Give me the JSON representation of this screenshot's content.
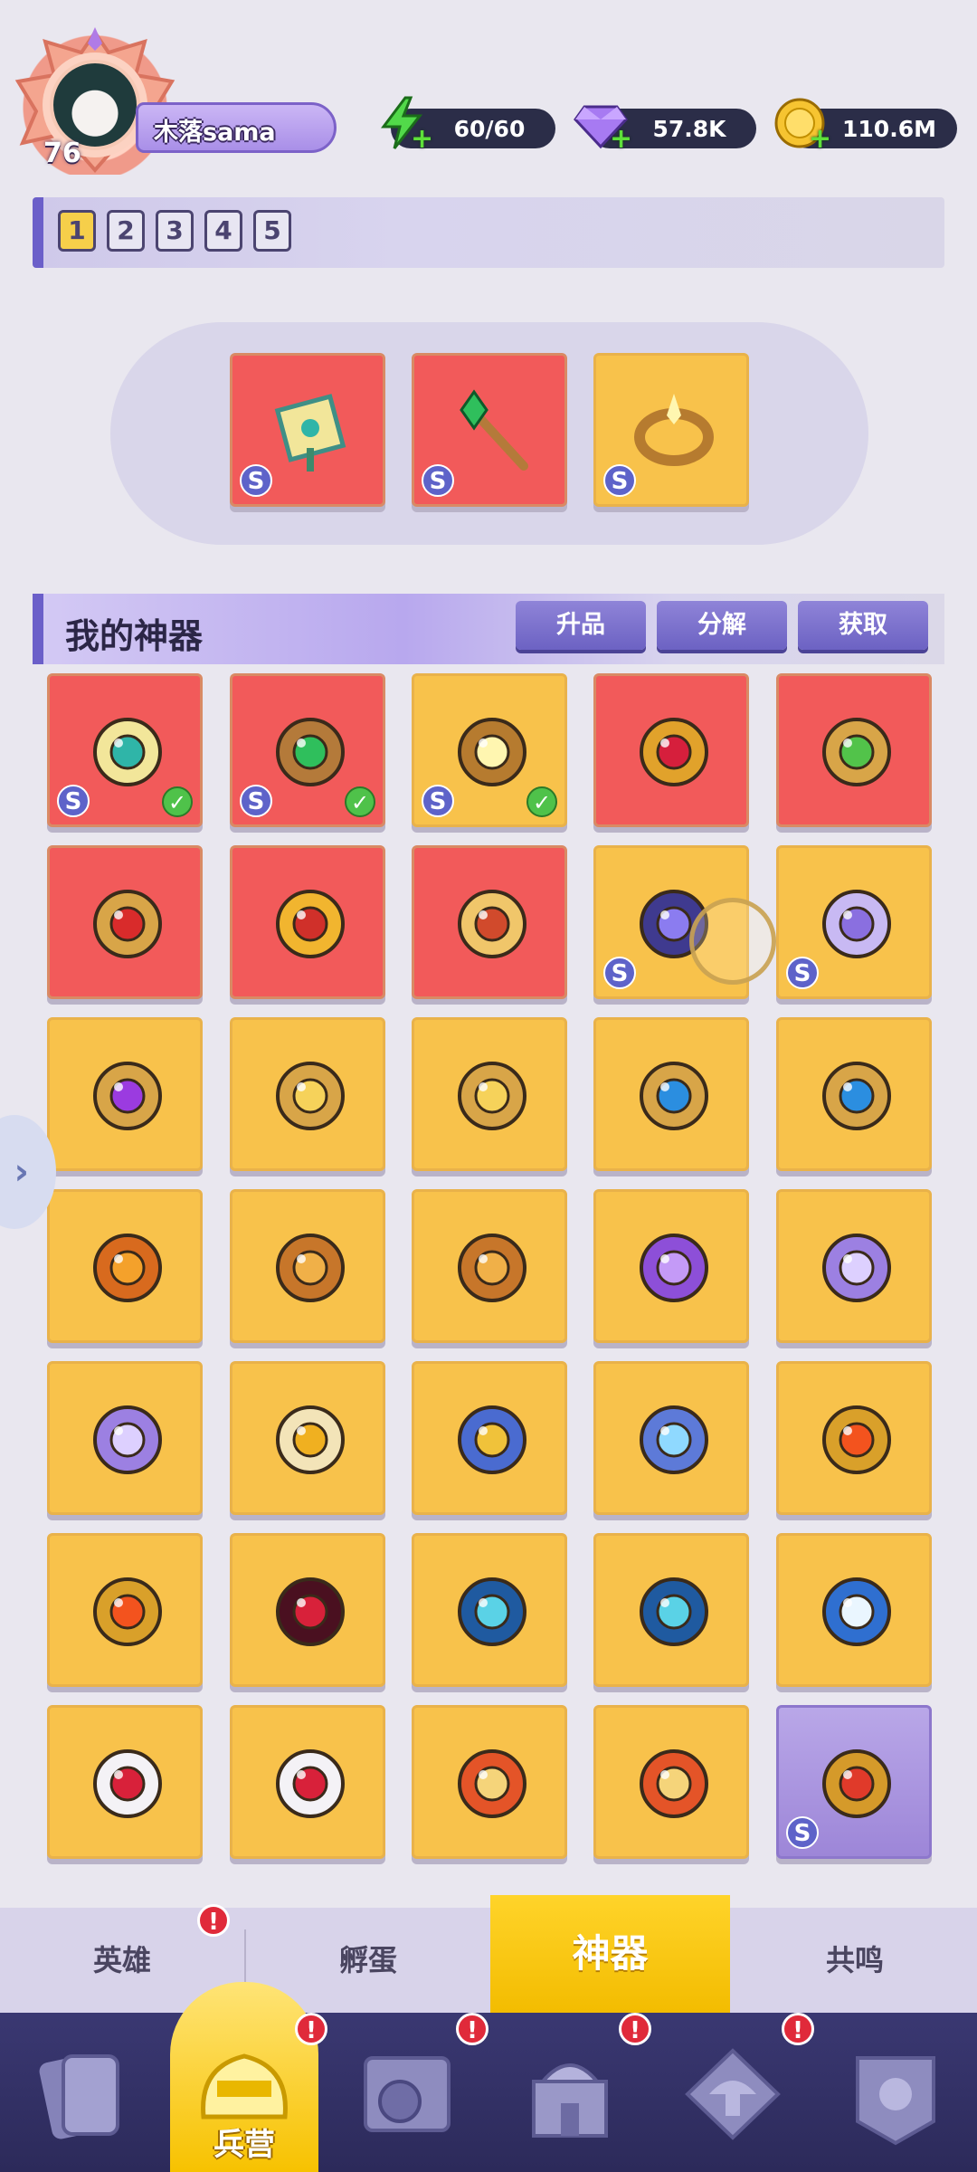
{
  "player": {
    "level": "76",
    "name": "木落sama"
  },
  "resources": {
    "energy": "60/60",
    "gems": "57.8K",
    "gold": "110.6M"
  },
  "page_tabs": [
    "1",
    "2",
    "3",
    "4",
    "5"
  ],
  "active_page": "1",
  "equipped": [
    {
      "icon": "map-scroll-icon",
      "grade": "S"
    },
    {
      "icon": "emerald-staff-icon",
      "grade": "S"
    },
    {
      "icon": "golden-ring-icon",
      "grade": "S"
    }
  ],
  "section": {
    "title": "我的神器",
    "buttons": [
      "升品",
      "分解",
      "获取"
    ]
  },
  "artifacts": [
    {
      "icon": "map-scroll-icon",
      "bg": "red",
      "grade": "S",
      "equipped": true
    },
    {
      "icon": "emerald-staff-icon",
      "bg": "red",
      "grade": "S",
      "equipped": true
    },
    {
      "icon": "golden-ring-icon",
      "bg": "gold",
      "grade": "S",
      "equipped": true
    },
    {
      "icon": "ruby-heart-crown-icon",
      "bg": "red",
      "grade": "",
      "equipped": false
    },
    {
      "icon": "green-amulet-icon",
      "bg": "red",
      "grade": "",
      "equipped": false
    },
    {
      "icon": "red-amulet-icon",
      "bg": "red",
      "grade": "",
      "equipped": false
    },
    {
      "icon": "jeweled-crown-icon",
      "bg": "red",
      "grade": "",
      "equipped": false
    },
    {
      "icon": "magic-scroll-icon",
      "bg": "red",
      "grade": "",
      "equipped": false
    },
    {
      "icon": "dark-wing-icon",
      "bg": "gold",
      "grade": "S",
      "equipped": false
    },
    {
      "icon": "crystal-orb-icon",
      "bg": "gold",
      "grade": "S",
      "equipped": false
    },
    {
      "icon": "purple-amulet-icon",
      "bg": "gold",
      "grade": "",
      "equipped": false
    },
    {
      "icon": "gold-amulet-icon",
      "bg": "gold",
      "grade": "",
      "equipped": false
    },
    {
      "icon": "gold-amulet-icon",
      "bg": "gold",
      "grade": "",
      "equipped": false
    },
    {
      "icon": "blue-amulet-icon",
      "bg": "gold",
      "grade": "",
      "equipped": false
    },
    {
      "icon": "blue-amulet-icon",
      "bg": "gold",
      "grade": "",
      "equipped": false
    },
    {
      "icon": "maple-leaf-icon",
      "bg": "gold",
      "grade": "",
      "equipped": false
    },
    {
      "icon": "bronze-bell-icon",
      "bg": "gold",
      "grade": "",
      "equipped": false
    },
    {
      "icon": "bronze-bell-icon",
      "bg": "gold",
      "grade": "",
      "equipped": false
    },
    {
      "icon": "purple-horn-icon",
      "bg": "gold",
      "grade": "",
      "equipped": false
    },
    {
      "icon": "purple-pouch-icon",
      "bg": "gold",
      "grade": "",
      "equipped": false
    },
    {
      "icon": "purple-pouch-icon",
      "bg": "gold",
      "grade": "",
      "equipped": false
    },
    {
      "icon": "potion-bottle-icon",
      "bg": "gold",
      "grade": "",
      "equipped": false
    },
    {
      "icon": "gold-hammer-icon",
      "bg": "gold",
      "grade": "",
      "equipped": false
    },
    {
      "icon": "ice-gauntlet-icon",
      "bg": "gold",
      "grade": "",
      "equipped": false
    },
    {
      "icon": "fire-gauntlet-icon",
      "bg": "gold",
      "grade": "",
      "equipped": false
    },
    {
      "icon": "fire-gauntlet-icon",
      "bg": "gold",
      "grade": "",
      "equipped": false
    },
    {
      "icon": "red-goblet-icon",
      "bg": "gold",
      "grade": "",
      "equipped": false
    },
    {
      "icon": "blue-chalice-icon",
      "bg": "gold",
      "grade": "",
      "equipped": false
    },
    {
      "icon": "blue-chalice-icon",
      "bg": "gold",
      "grade": "",
      "equipped": false
    },
    {
      "icon": "frost-clock-icon",
      "bg": "gold",
      "grade": "",
      "equipped": false
    },
    {
      "icon": "dice-icon",
      "bg": "gold",
      "grade": "",
      "equipped": false
    },
    {
      "icon": "dice-icon",
      "bg": "gold",
      "grade": "",
      "equipped": false
    },
    {
      "icon": "war-drum-icon",
      "bg": "gold",
      "grade": "",
      "equipped": false
    },
    {
      "icon": "war-drum-icon",
      "bg": "gold",
      "grade": "",
      "equipped": false
    },
    {
      "icon": "ruby-astrolabe-icon",
      "bg": "purple",
      "grade": "S",
      "equipped": false
    }
  ],
  "category_tabs": [
    {
      "label": "英雄",
      "alert": "!"
    },
    {
      "label": "孵蛋",
      "alert": ""
    },
    {
      "label": "神器",
      "alert": ""
    },
    {
      "label": "共鸣",
      "alert": ""
    }
  ],
  "active_category": "神器",
  "bottom_nav": [
    {
      "icon": "cards-icon",
      "label": "",
      "alert": ""
    },
    {
      "icon": "barracks-helmet-icon",
      "label": "兵营",
      "alert": "!"
    },
    {
      "icon": "map-compass-icon",
      "label": "",
      "alert": "!"
    },
    {
      "icon": "castle-icon",
      "label": "",
      "alert": "!"
    },
    {
      "icon": "mushroom-guild-icon",
      "label": "",
      "alert": "!"
    },
    {
      "icon": "shield-banner-icon",
      "label": "",
      "alert": ""
    }
  ],
  "colors": {
    "card_red": "#f25a5a",
    "card_gold": "#f8c24b",
    "card_purple": "#a891dd",
    "accent_purple": "#6b5fc9",
    "active_tab_yellow": "#f7c200",
    "alert_red": "#e02a3a",
    "grade_badge": "#5e63c9"
  }
}
